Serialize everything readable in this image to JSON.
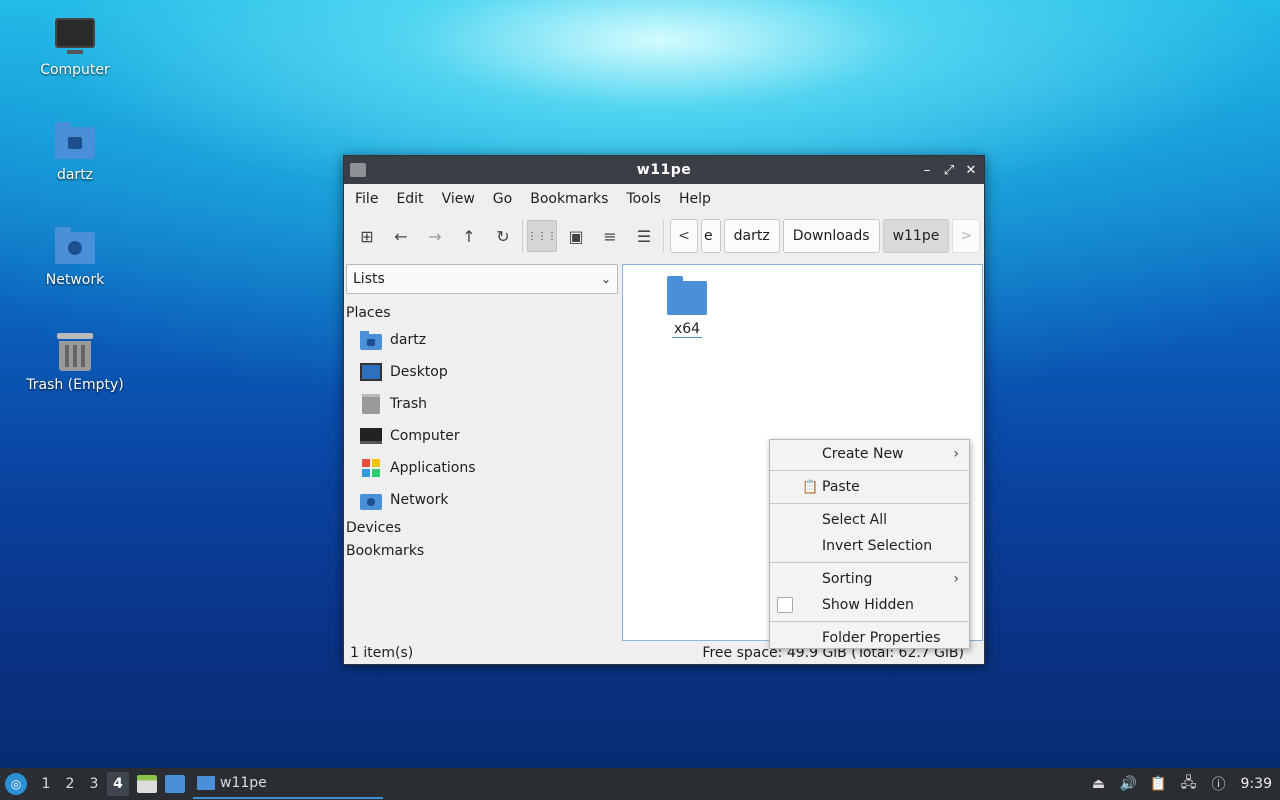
{
  "desktop": {
    "icons": [
      {
        "label": "Computer"
      },
      {
        "label": "dartz"
      },
      {
        "label": "Network"
      },
      {
        "label": "Trash (Empty)"
      }
    ]
  },
  "window": {
    "title": "w11pe",
    "controls": {
      "minimize": "–",
      "maximize": "⤢",
      "close": "✕"
    },
    "menu": [
      "File",
      "Edit",
      "View",
      "Go",
      "Bookmarks",
      "Tools",
      "Help"
    ],
    "toolbar_icons": {
      "new_tab": "⊞",
      "back": "←",
      "forward": "→",
      "up": "↑",
      "reload": "↻",
      "icon_view": "⋮⋮⋮",
      "thumbnail_view": "▣",
      "compact_view": "≡",
      "detailed_view": "☰"
    },
    "breadcrumbs": {
      "prev_arrow": "<",
      "partial": "e",
      "items": [
        "dartz",
        "Downloads",
        "w11pe"
      ],
      "next_arrow": ">"
    },
    "sidepane": {
      "mode": "Lists",
      "places_heading": "Places",
      "places": [
        "dartz",
        "Desktop",
        "Trash",
        "Computer",
        "Applications",
        "Network"
      ],
      "devices_heading": "Devices",
      "bookmarks_heading": "Bookmarks"
    },
    "files": [
      {
        "name": "x64"
      }
    ],
    "status": {
      "items": "1 item(s)",
      "free_space": "Free space: 49.9 GiB (Total: 62.7 GiB)"
    }
  },
  "context_menu": {
    "create_new": "Create New",
    "paste": "Paste",
    "select_all": "Select All",
    "invert_selection": "Invert Selection",
    "sorting": "Sorting",
    "show_hidden": "Show Hidden",
    "folder_properties": "Folder Properties"
  },
  "taskbar": {
    "workspaces": [
      "1",
      "2",
      "3",
      "4"
    ],
    "active_workspace": "4",
    "task_label": "w11pe",
    "clock": "9:39"
  },
  "colors": {
    "accent": "#4a90d9",
    "titlebar": "#3b3f45",
    "taskbar": "#2a2e33"
  }
}
